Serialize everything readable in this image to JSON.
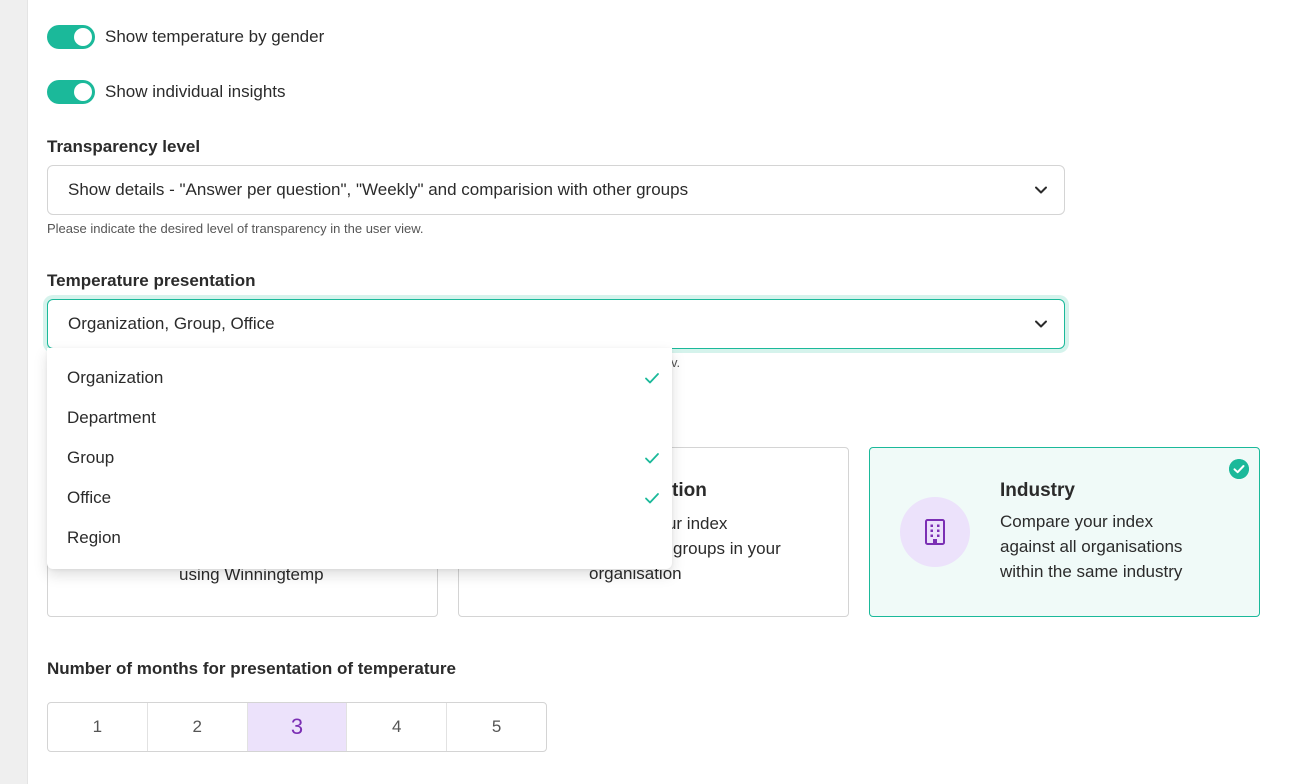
{
  "toggles": [
    {
      "label": "Show temperature by gender",
      "on": true
    },
    {
      "label": "Show individual insights",
      "on": true
    }
  ],
  "transparency": {
    "label": "Transparency level",
    "value": "Show details - \"Answer per question\", \"Weekly\" and comparision with other groups",
    "helper": "Please indicate the desired level of transparency in the user view."
  },
  "temperature": {
    "label": "Temperature presentation",
    "value": "Organization, Group, Office",
    "helper_visible_fragment": "v."
  },
  "dropdown": {
    "options": [
      {
        "label": "Organization",
        "checked": true
      },
      {
        "label": "Department",
        "checked": false
      },
      {
        "label": "Group",
        "checked": true
      },
      {
        "label": "Office",
        "checked": true
      },
      {
        "label": "Region",
        "checked": false
      }
    ]
  },
  "cards": {
    "card1": {
      "text": "using Winningtemp"
    },
    "card2": {
      "title_fragment": "tion",
      "line1_fragment": "your index",
      "line2_fragment": "groups in your",
      "line3": "organisation"
    },
    "industry": {
      "title": "Industry",
      "line1": "Compare your index",
      "line2": "against all organisations",
      "line3": "within the same industry",
      "selected": true,
      "icon": "building-icon"
    }
  },
  "months": {
    "label": "Number of months for presentation of temperature",
    "options": [
      "1",
      "2",
      "3",
      "4",
      "5"
    ],
    "selected": "3"
  },
  "colors": {
    "accent": "#1bb99a",
    "purple": "#7b2fb4",
    "purple_light": "#ece2fb"
  }
}
